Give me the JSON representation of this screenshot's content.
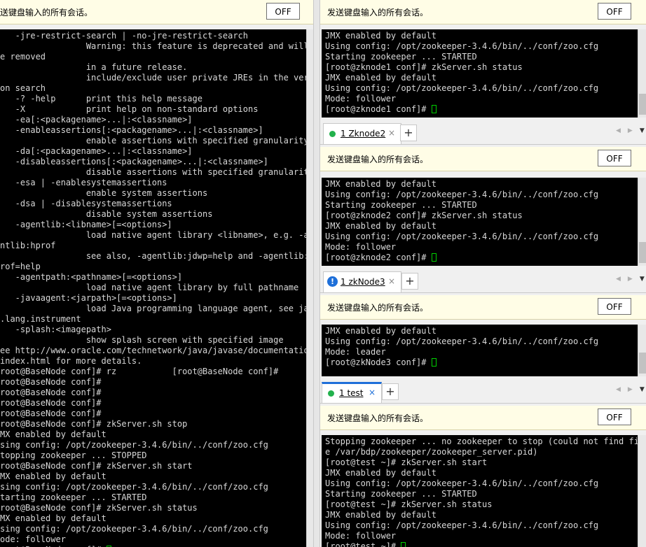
{
  "broadcast": {
    "label": "发送键盘输入的所有会话。",
    "off_label": "OFF"
  },
  "left_terminal": {
    "lines": [
      "   -jre-restrict-search | -no-jre-restrict-search",
      "                 Warning: this feature is deprecated and will",
      "e removed",
      "                 in a future release.",
      "                 include/exclude user private JREs in the vers",
      "on search",
      "   -? -help      print this help message",
      "   -X            print help on non-standard options",
      "   -ea[:<packagename>...|:<classname>]",
      "   -enableassertions[:<packagename>...|:<classname>]",
      "                 enable assertions with specified granularity",
      "   -da[:<packagename>...|:<classname>]",
      "   -disableassertions[:<packagename>...|:<classname>]",
      "                 disable assertions with specified granularity",
      "   -esa | -enablesystemassertions",
      "                 enable system assertions",
      "   -dsa | -disablesystemassertions",
      "                 disable system assertions",
      "   -agentlib:<libname>[=<options>]",
      "                 load native agent library <libname>, e.g. -ag",
      "ntlib:hprof",
      "                 see also, -agentlib:jdwp=help and -agentlib:h",
      "rof=help",
      "   -agentpath:<pathname>[=<options>]",
      "                 load native agent library by full pathname",
      "   -javaagent:<jarpath>[=<options>]",
      "                 load Java programming language agent, see jav",
      ".lang.instrument",
      "   -splash:<imagepath>",
      "                 show splash screen with specified image",
      "ee http://www.oracle.com/technetwork/java/javase/documentation",
      "index.html for more details.",
      "root@BaseNode conf]# rz           [root@BaseNode conf]#",
      "root@BaseNode conf]#",
      "root@BaseNode conf]#",
      "root@BaseNode conf]#",
      "root@BaseNode conf]#",
      "root@BaseNode conf]# zkServer.sh stop",
      "MX enabled by default",
      "sing config: /opt/zookeeper-3.4.6/bin/../conf/zoo.cfg",
      "topping zookeeper ... STOPPED",
      "root@BaseNode conf]# zkServer.sh start",
      "MX enabled by default",
      "sing config: /opt/zookeeper-3.4.6/bin/../conf/zoo.cfg",
      "tarting zookeeper ... STARTED",
      "root@BaseNode conf]# zkServer.sh status",
      "MX enabled by default",
      "sing config: /opt/zookeeper-3.4.6/bin/../conf/zoo.cfg",
      "ode: follower",
      "root@BaseNode conf]# "
    ]
  },
  "sessions": [
    {
      "tab_label": "",
      "lines": [
        "JMX enabled by default",
        "Using config: /opt/zookeeper-3.4.6/bin/../conf/zoo.cfg",
        "Starting zookeeper ... STARTED",
        "[root@zknode1 conf]# zkServer.sh status",
        "JMX enabled by default",
        "Using config: /opt/zookeeper-3.4.6/bin/../conf/zoo.cfg",
        "Mode: follower",
        "[root@zknode1 conf]# "
      ]
    },
    {
      "tab_label": "1 Zknode2",
      "status": "connected",
      "lines": [
        "JMX enabled by default",
        "Using config: /opt/zookeeper-3.4.6/bin/../conf/zoo.cfg",
        "Starting zookeeper ... STARTED",
        "[root@zknode2 conf]# zkServer.sh status",
        "JMX enabled by default",
        "Using config: /opt/zookeeper-3.4.6/bin/../conf/zoo.cfg",
        "Mode: follower",
        "[root@zknode2 conf]# "
      ]
    },
    {
      "tab_label": "1 zkNode3",
      "status": "warning",
      "lines": [
        "JMX enabled by default",
        "Using config: /opt/zookeeper-3.4.6/bin/../conf/zoo.cfg",
        "Mode: leader",
        "[root@zkNode3 conf]# "
      ]
    },
    {
      "tab_label": "1 test",
      "status": "connected",
      "lines": [
        "Stopping zookeeper ... no zookeeper to stop (could not find fil",
        "e /var/bdp/zookeeper/zookeeper_server.pid)",
        "[root@test ~]# zkServer.sh start",
        "JMX enabled by default",
        "Using config: /opt/zookeeper-3.4.6/bin/../conf/zoo.cfg",
        "Starting zookeeper ... STARTED",
        "[root@test ~]# zkServer.sh status",
        "JMX enabled by default",
        "Using config: /opt/zookeeper-3.4.6/bin/../conf/zoo.cfg",
        "Mode: follower",
        "[root@test ~]# "
      ]
    }
  ],
  "icons": {
    "close": "close-icon",
    "add": "plus-icon",
    "nav": "arrow-left-right-icon",
    "menu": "chevron-down-icon"
  },
  "colors": {
    "connected": "#22b14c",
    "warning": "#1e6fd9",
    "cursor": "#00d000",
    "terminal_bg": "#000000",
    "broadcast_bg": "#fffde6"
  }
}
